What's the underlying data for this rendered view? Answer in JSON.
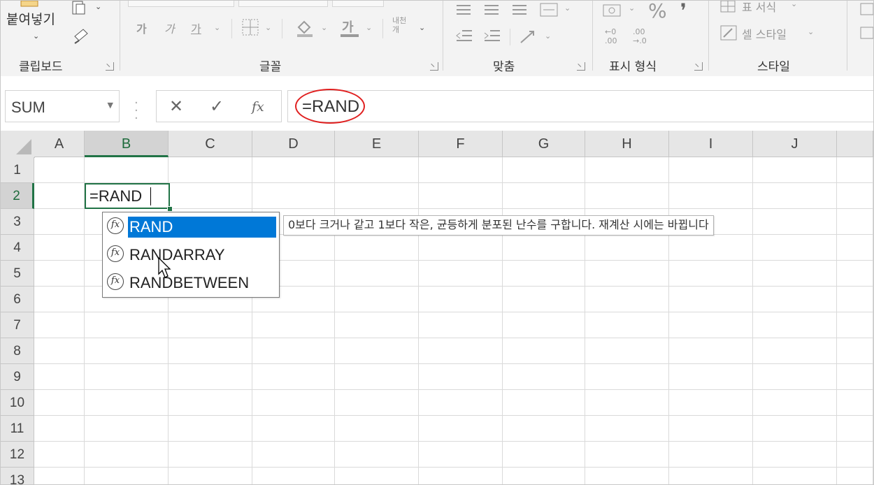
{
  "ribbon": {
    "clipboard": {
      "paste_label": "붙여넣기",
      "group_label": "클립보드"
    },
    "font": {
      "bold_glyph": "가",
      "italic_glyph": "가",
      "underline_glyph": "가",
      "font_color_glyph": "가",
      "phonetic_label": "내천\n개",
      "group_label": "글꼴"
    },
    "alignment": {
      "group_label": "맞춤"
    },
    "number": {
      "percent_glyph": "%",
      "comma_glyph": "❜",
      "inc_decimal": "←0\n.00",
      "dec_decimal": ".00\n→.0",
      "group_label": "표시 형식"
    },
    "styles": {
      "format_as_table_label": "표 서식",
      "cell_styles_label": "셀 스타일",
      "group_label": "스타일"
    }
  },
  "formula_bar": {
    "name_box": "SUM",
    "cancel_glyph": "✕",
    "enter_glyph": "✓",
    "fx_glyph": "fx",
    "formula": "=RAND"
  },
  "sheet": {
    "columns": [
      "A",
      "B",
      "C",
      "D",
      "E",
      "F",
      "G",
      "H",
      "I",
      "J"
    ],
    "rows": [
      "1",
      "2",
      "3",
      "4",
      "5",
      "6",
      "7",
      "8",
      "9",
      "10",
      "11",
      "12",
      "13"
    ],
    "active_cell_text": "=RAND"
  },
  "autocomplete": {
    "items": [
      {
        "label": "RAND"
      },
      {
        "label": "RANDARRAY"
      },
      {
        "label": "RANDBETWEEN"
      }
    ],
    "icon_glyph": "fx",
    "tooltip": "0보다 크거나 같고 1보다 작은, 균등하게 분포된 난수를 구합니다. 재계산 시에는 바뀝니다"
  },
  "colors": {
    "accent_green": "#217346",
    "selection_blue": "#0078d7",
    "highlight_circle": "#e02020"
  }
}
